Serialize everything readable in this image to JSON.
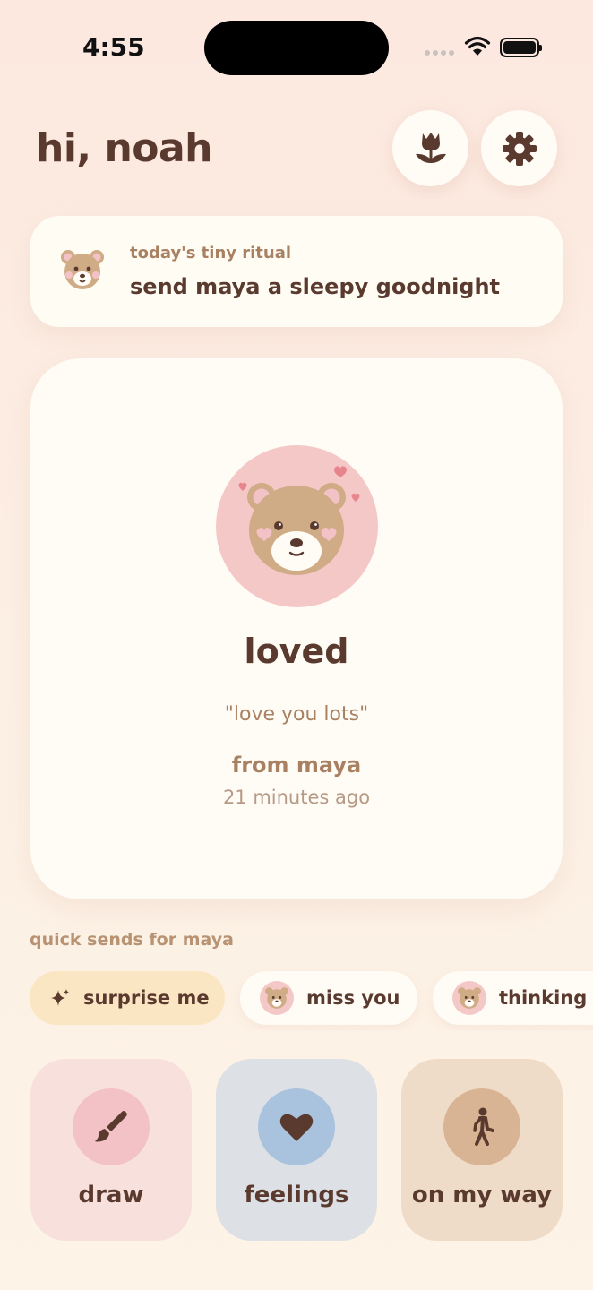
{
  "status_bar": {
    "time": "4:55"
  },
  "header": {
    "greeting": "hi, noah",
    "flower_icon": "tulip-icon",
    "settings_icon": "gear-icon"
  },
  "ritual": {
    "label": "today's tiny ritual",
    "text": "send maya a sleepy goodnight",
    "icon": "bear-face-icon"
  },
  "mood_card": {
    "mood": "loved",
    "message": "\"love you lots\"",
    "from": "from maya",
    "time_ago": "21 minutes ago",
    "icon": "bear-with-hearts-icon"
  },
  "quick_sends": {
    "label": "quick sends for maya",
    "chips": [
      {
        "label": "surprise me",
        "icon": "sparkle-icon"
      },
      {
        "label": "miss you",
        "icon": "bear-face-icon"
      },
      {
        "label": "thinking of you",
        "icon": "bear-face-icon"
      }
    ]
  },
  "actions": [
    {
      "label": "draw",
      "icon": "brush-icon"
    },
    {
      "label": "feelings",
      "icon": "heart-icon"
    },
    {
      "label": "on my way",
      "icon": "walking-icon"
    }
  ],
  "colors": {
    "text_brown": "#5a3a2e",
    "muted_brown": "#a88062",
    "card": "#fffcf6",
    "pink": "#f5c8c8",
    "bear": "#cfab86"
  }
}
